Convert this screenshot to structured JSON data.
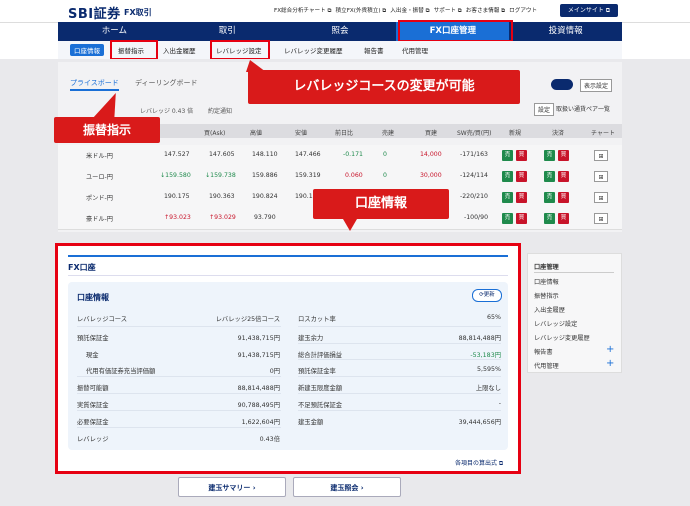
{
  "header": {
    "logo": "SBI証券",
    "logo_sub": "FX取引",
    "links": [
      "FX総合分析チャート ⧉",
      "積立FX(外貨積立) ⧉",
      "入出金・振替 ⧉",
      "サポート ⧉",
      "お客さま情報 ⧉",
      "ログアウト"
    ],
    "main_site_button": "メインサイト ⧉"
  },
  "nav": [
    "ホーム",
    "取引",
    "照会",
    "FX口座管理",
    "投資情報"
  ],
  "subnav": [
    "口座情報",
    "振替指示",
    "入出金履歴",
    "レバレッジ設定",
    "レバレッジ変更履歴",
    "報告書",
    "代用管理"
  ],
  "rate_panel": {
    "tabs": [
      "プライスボード",
      "ディーリングボード"
    ],
    "display_setting": "表示設定",
    "settings_button": "設定",
    "pair_link": "取扱い通貨ペア一覧",
    "leverage_fragment": "レバレッジ 0.43 倍",
    "order_notice": "約定通知",
    "headers": [
      "買(Ask)",
      "高値",
      "安値",
      "前日比",
      "売建",
      "買建",
      "SW売/買(円)",
      "新規",
      "決済",
      "チャート"
    ],
    "rows": [
      {
        "pair": "米ドル-円",
        "bid": "147.527",
        "ask": "147.605",
        "high": "148.110",
        "low": "147.466",
        "change": "-0.171",
        "sell": "0",
        "buy": "14,000",
        "swap": "-171/163"
      },
      {
        "pair": "ユーロ-円",
        "bid": "↓159.580",
        "ask": "↓159.738",
        "high": "159.886",
        "low": "159.319",
        "change": "0.060",
        "sell": "0",
        "buy": "30,000",
        "swap": "-124/114"
      },
      {
        "pair": "ポンド-円",
        "bid": "190.175",
        "ask": "190.363",
        "high": "190.824",
        "low": "190.1",
        "change": "",
        "sell": "",
        "buy": "",
        "swap": "-220/210"
      },
      {
        "pair": "豪ドル-円",
        "bid": "↑93.023",
        "ask": "↑93.029",
        "high": "93.790",
        "low": "",
        "change": "",
        "sell": "",
        "buy": "",
        "swap": "-100/90"
      }
    ],
    "sell_label": "売",
    "buy_label": "買"
  },
  "callouts": {
    "leverage": "レバレッジコースの変更が可能",
    "transfer": "振替指示",
    "account": "口座情報"
  },
  "account_panel": {
    "title": "FX口座",
    "card_title": "口座情報",
    "refresh": "⟳更新",
    "left": [
      {
        "label": "レバレッジコース",
        "value": "レバレッジ25倍コース"
      },
      {
        "label": "預託保証金",
        "value": "91,438,715円"
      },
      {
        "label": "現金",
        "value": "91,438,715円"
      },
      {
        "label": "代用有価証券充当評価額",
        "value": "0円"
      },
      {
        "label": "振替可能額",
        "value": "88,814,488円"
      },
      {
        "label": "実質保証金",
        "value": "90,788,495円"
      },
      {
        "label": "必要保証金",
        "value": "1,622,604円"
      },
      {
        "label": "レバレッジ",
        "value": "0.43倍"
      }
    ],
    "right": [
      {
        "label": "ロスカット率",
        "value": "65%"
      },
      {
        "label": "建玉余力",
        "value": "88,814,488円"
      },
      {
        "label": "総合計評価損益",
        "value": "-53,183円"
      },
      {
        "label": "預託保証金率",
        "value": "5,595%"
      },
      {
        "label": "新建玉限度金額",
        "value": "上限なし"
      },
      {
        "label": "不足預託保証金",
        "value": "-"
      },
      {
        "label": "建玉金額",
        "value": "39,444,656円"
      }
    ],
    "calc_link": "各項目の算出式 ⧉"
  },
  "side_menu": {
    "title": "口座管理",
    "items": [
      "口座情報",
      "振替指示",
      "入出金履歴",
      "レバレッジ設定",
      "レバレッジ変更履歴",
      "報告書",
      "代用管理"
    ]
  },
  "bottom_buttons": [
    "建玉サマリー ›",
    "建玉照会 ›"
  ],
  "colors": {
    "navy": "#0a2a6e",
    "accent": "#1a6fd6",
    "highlight_red": "#e60012",
    "loss_green": "#1f8a4c"
  }
}
